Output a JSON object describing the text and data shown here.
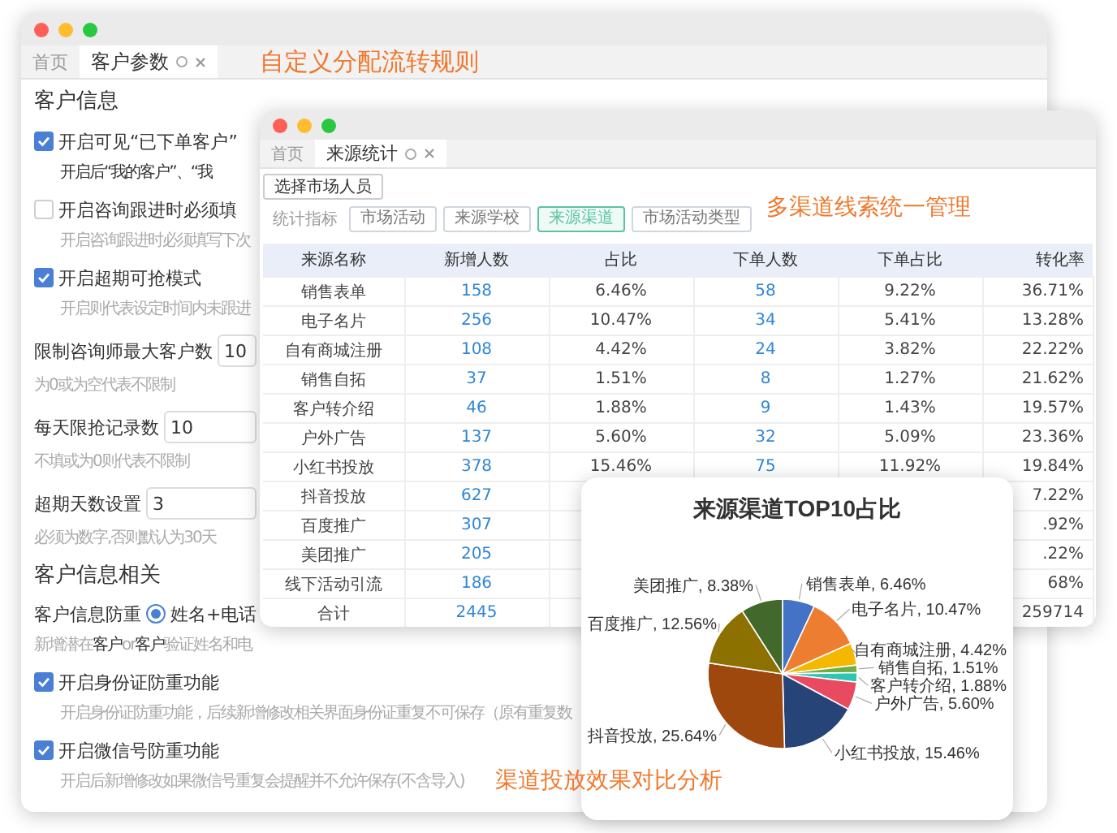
{
  "back_window": {
    "tabs": [
      {
        "label": "首页",
        "selected": false
      },
      {
        "label": "客户参数",
        "selected": true
      }
    ],
    "caption": "自定义分配流转规则",
    "settings": [
      {
        "kind": "section",
        "label": "客户信息"
      },
      {
        "kind": "checkbox",
        "label": "开启可见“已下单客户”",
        "checked": true
      },
      {
        "kind": "subnote",
        "text": "开启后“我的客户”、“我"
      },
      {
        "kind": "checkbox",
        "label": "开启咨询跟进时必须填",
        "checked": false
      },
      {
        "kind": "note",
        "text": "开启咨询跟进时必须填写下次"
      },
      {
        "kind": "checkbox",
        "label": "开启超期可抢模式",
        "checked": true
      },
      {
        "kind": "note",
        "text": "开启则代表设定时间内未跟进"
      },
      {
        "kind": "number",
        "label": "限制咨询师最大客户数",
        "value": "10"
      },
      {
        "kind": "note",
        "text": "为0或为空代表不限制"
      },
      {
        "kind": "number",
        "label": "每天限抢记录数",
        "value": "10"
      },
      {
        "kind": "note",
        "text": "不填或为0则代表不限制"
      },
      {
        "kind": "number",
        "label": "超期天数设置",
        "value": "3"
      },
      {
        "kind": "note",
        "text": "必须为数字,否则默认为30天"
      },
      {
        "kind": "section",
        "label": "客户信息相关"
      },
      {
        "kind": "radio",
        "label": "客户信息防重",
        "option": "姓名+电话",
        "selected": true
      },
      {
        "kind": "note",
        "text": "新增潜在**客户**or**客户**验证姓名和电"
      },
      {
        "kind": "checkbox",
        "label": "开启身份证防重功能",
        "checked": true
      },
      {
        "kind": "note",
        "text": "开启身份证防重功能，后续新增修改相关界面身份证重复不可保存（原有重复数"
      },
      {
        "kind": "checkbox",
        "label": "开启微信号防重功能",
        "checked": true
      },
      {
        "kind": "note",
        "text": "开启后新增修改如果微信号重复会提醒并不允许保存(不含导入)"
      }
    ]
  },
  "stats_window": {
    "tabs": [
      {
        "label": "首页",
        "selected": false
      },
      {
        "label": "来源统计",
        "selected": true
      }
    ],
    "select_button": "选择市场人员",
    "filter_label": "统计指标",
    "filters": [
      {
        "label": "市场活动",
        "selected": false
      },
      {
        "label": "来源学校",
        "selected": false
      },
      {
        "label": "来源渠道",
        "selected": true
      },
      {
        "label": "市场活动类型",
        "selected": false
      }
    ],
    "caption": "多渠道线索统一管理",
    "table": {
      "columns": [
        "来源名称",
        "新增人数",
        "占比",
        "下单人数",
        "下单占比",
        "转化率"
      ],
      "rows": [
        {
          "name": "销售表单",
          "new_count": "158",
          "share": "6.46%",
          "order_count": "58",
          "order_share": "9.22%",
          "rate": "36.71%"
        },
        {
          "name": "电子名片",
          "new_count": "256",
          "share": "10.47%",
          "order_count": "34",
          "order_share": "5.41%",
          "rate": "13.28%"
        },
        {
          "name": "自有商城注册",
          "new_count": "108",
          "share": "4.42%",
          "order_count": "24",
          "order_share": "3.82%",
          "rate": "22.22%"
        },
        {
          "name": "销售自拓",
          "new_count": "37",
          "share": "1.51%",
          "order_count": "8",
          "order_share": "1.27%",
          "rate": "21.62%"
        },
        {
          "name": "客户转介绍",
          "new_count": "46",
          "share": "1.88%",
          "order_count": "9",
          "order_share": "1.43%",
          "rate": "19.57%"
        },
        {
          "name": "户外广告",
          "new_count": "137",
          "share": "5.60%",
          "order_count": "32",
          "order_share": "5.09%",
          "rate": "23.36%"
        },
        {
          "name": "小红书投放",
          "new_count": "378",
          "share": "15.46%",
          "order_count": "75",
          "order_share": "11.92%",
          "rate": "19.84%"
        },
        {
          "name": "抖音投放",
          "new_count": "627",
          "rate": "7.22%"
        },
        {
          "name": "百度推广",
          "new_count": "307",
          "rate": ".92%"
        },
        {
          "name": "美团推广",
          "new_count": "205",
          "rate": ".22%"
        },
        {
          "name": "线下活动引流",
          "new_count": "186",
          "rate": "68%"
        },
        {
          "name": "合计",
          "new_count": "2445",
          "rate": "259714"
        }
      ]
    }
  },
  "pie_card": {
    "chart_data": {
      "type": "pie",
      "title": "来源渠道TOP10占比",
      "values": [
        6.46,
        10.47,
        4.42,
        1.51,
        1.88,
        5.6,
        15.46,
        25.64,
        12.56,
        8.38
      ],
      "value_labels": [
        "销售表单, 6.46%",
        "电子名片, 10.47%",
        "自有商城注册, 4.42%",
        "销售自拓, 1.51%",
        "客户转介绍, 1.88%",
        "户外广告, 5.60%",
        "小红书投放, 15.46%",
        "抖音投放, 25.64%",
        "百度推广, 12.56%",
        "美团推广, 8.38%"
      ]
    }
  },
  "overlay_caption": "渠道投放效果对比分析"
}
